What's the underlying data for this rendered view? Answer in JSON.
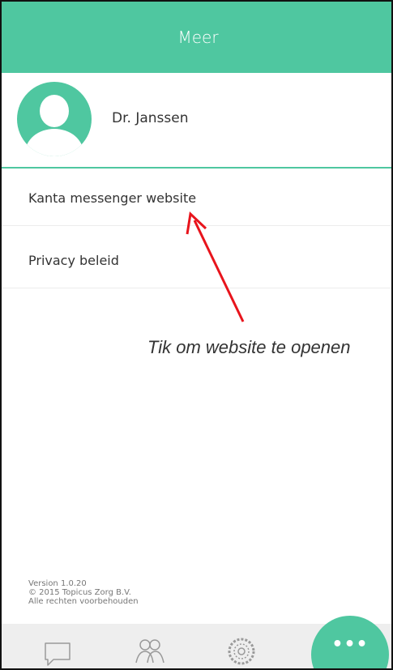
{
  "header": {
    "title": "Meer"
  },
  "profile": {
    "name": "Dr. Janssen"
  },
  "menu": {
    "items": [
      {
        "label": "Kanta messenger website"
      },
      {
        "label": "Privacy beleid"
      }
    ]
  },
  "annotation": {
    "text": "Tik om website te openen"
  },
  "footer": {
    "version": "Version 1.0.20",
    "copyright": "© 2015 Topicus Zorg B.V.",
    "rights": "Alle rechten voorbehouden"
  },
  "tabbar": {
    "icons": [
      "chat-icon",
      "people-icon",
      "organization-icon"
    ],
    "more_label": "•••"
  },
  "colors": {
    "accent": "#4fc7a0",
    "annotation_arrow": "#e8141c",
    "tabbar_bg": "#eeeeee"
  }
}
